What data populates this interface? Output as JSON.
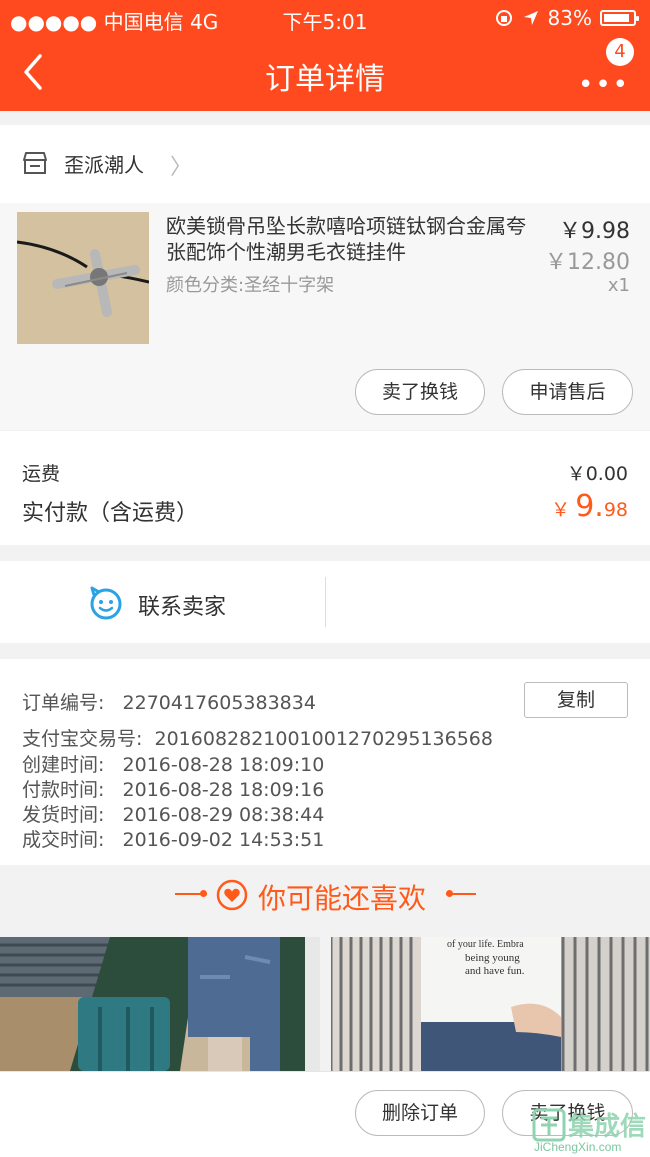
{
  "status_bar": {
    "signal": "●●●●● 中国电信  4G",
    "time": "下午5:01",
    "battery": "83%"
  },
  "nav": {
    "title": "订单详情",
    "badge_count": "4",
    "more": "•••"
  },
  "shop": {
    "name": "歪派潮人",
    "chevron": "〉"
  },
  "product": {
    "title": "欧美锁骨吊坠长款嘻哈项链钛钢合金属夸张配饰个性潮男毛衣链挂件",
    "sku": "颜色分类:圣经十字架",
    "price": "￥9.98",
    "original_price": "￥12.80",
    "quantity": "x1",
    "buttons": [
      "卖了换钱",
      "申请售后"
    ]
  },
  "fees": {
    "shipping_label": "运费",
    "shipping_value": "￥0.00",
    "paid_label": "实付款（含运费）",
    "paid_symbol": "￥",
    "paid_int": "9.",
    "paid_dec": "98"
  },
  "contact": {
    "label": "联系卖家"
  },
  "order_info": {
    "order_no_label": "订单编号:",
    "order_no": "2270417605383834",
    "copy_label": "复制",
    "alipay_label": "支付宝交易号:",
    "alipay_no": "2016082821001001270295136568",
    "created_label": "创建时间:",
    "created": "2016-08-28 18:09:10",
    "paid_label": "付款时间:",
    "paid": "2016-08-28 18:09:16",
    "shipped_label": "发货时间:",
    "shipped": "2016-08-29 08:38:44",
    "completed_label": "成交时间:",
    "completed": "2016-09-02 14:53:51"
  },
  "recommend": {
    "title": "你可能还喜欢",
    "shirt_text": [
      "of your life. Embra",
      "being young",
      "and have fun."
    ]
  },
  "bottom": {
    "delete_label": "删除订单",
    "sell_label": "卖了换钱"
  },
  "watermark": {
    "text": "集成信",
    "sub": "JiChengXin.com"
  },
  "colors": {
    "brand": "#ff4a1f",
    "accent_price": "#ff5a1a",
    "contact_icon": "#29a3e6"
  }
}
